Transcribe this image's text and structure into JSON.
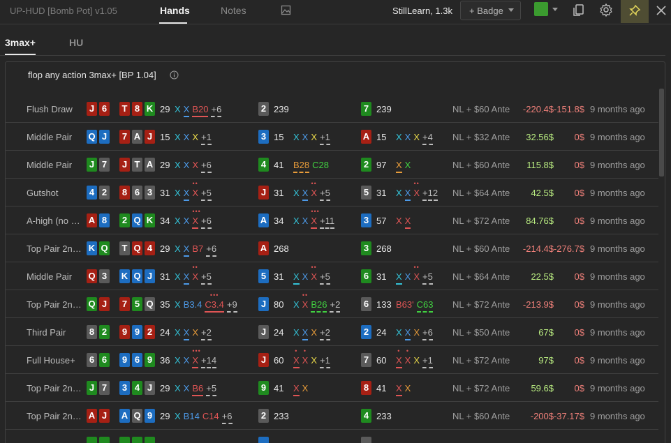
{
  "app": {
    "title": "UP-HUD [Bomb Pot] v1.05",
    "tabs": [
      "Hands",
      "Notes"
    ],
    "active_tab": "Hands",
    "user": "StillLearn, 1.3k",
    "badge_button": "+ Badge",
    "color_swatch": "#3b9b2f"
  },
  "subtabs": [
    "3max+",
    "HU"
  ],
  "panel": {
    "title": "flop any action 3max+ [BP 1.04]"
  },
  "colors": {
    "heart": "#a62014",
    "diamond": "#1d6dc0",
    "club": "#1f8a1f",
    "spade": "#5a5a5a",
    "positive": "#b8ea80",
    "negative": "#f0807a"
  },
  "rows": [
    {
      "name": "Flush Draw",
      "hole": [
        [
          "J",
          "h"
        ],
        [
          "6",
          "h"
        ]
      ],
      "flop": [
        [
          "T",
          "h"
        ],
        [
          "8",
          "h"
        ],
        [
          "K",
          "c"
        ]
      ],
      "pot": "29",
      "acts": [
        {
          "t": "X",
          "c": "cyan"
        },
        {
          "t": "X",
          "c": "blue",
          "u": 1
        },
        {
          "t": "B20",
          "c": "red",
          "u": 1
        },
        {
          "t": "+6",
          "c": "gray",
          "d": 1
        }
      ],
      "p2": {
        "card": [
          "2",
          "s"
        ],
        "pot": "239",
        "acts": []
      },
      "p3": {
        "card": [
          "7",
          "c"
        ],
        "pot": "239",
        "acts": []
      },
      "game": "NL + $60 Ante",
      "m1": "-220.4$",
      "m1s": "neg",
      "m2": "-151.8$",
      "m2s": "neg",
      "time": "9 months ago"
    },
    {
      "name": "Middle Pair",
      "hole": [
        [
          "Q",
          "d"
        ],
        [
          "J",
          "d"
        ]
      ],
      "flop": [
        [
          "7",
          "h"
        ],
        [
          "A",
          "s"
        ],
        [
          "J",
          "h"
        ]
      ],
      "pot": "15",
      "acts": [
        {
          "t": "X",
          "c": "cyan"
        },
        {
          "t": "X",
          "c": "blue"
        },
        {
          "t": "X",
          "c": "yellow"
        },
        {
          "t": "+1",
          "c": "gray",
          "d": 1
        }
      ],
      "p2": {
        "card": [
          "3",
          "d"
        ],
        "pot": "15",
        "acts": [
          {
            "t": "X",
            "c": "cyan"
          },
          {
            "t": "X",
            "c": "blue"
          },
          {
            "t": "X",
            "c": "yellow"
          },
          {
            "t": "+1",
            "c": "gray",
            "d": 1
          }
        ]
      },
      "p3": {
        "card": [
          "A",
          "h"
        ],
        "pot": "15",
        "acts": [
          {
            "t": "X",
            "c": "cyan"
          },
          {
            "t": "X",
            "c": "blue"
          },
          {
            "t": "X",
            "c": "yellow"
          },
          {
            "t": "+4",
            "c": "gray",
            "d": 1
          }
        ]
      },
      "game": "NL + $32 Ante",
      "m1": "32.56$",
      "m1s": "pos",
      "m2": "0$",
      "m2s": "neg",
      "time": "9 months ago"
    },
    {
      "name": "Middle Pair",
      "hole": [
        [
          "J",
          "c"
        ],
        [
          "7",
          "s"
        ]
      ],
      "flop": [
        [
          "J",
          "h"
        ],
        [
          "T",
          "s"
        ],
        [
          "A",
          "s"
        ]
      ],
      "pot": "29",
      "acts": [
        {
          "t": "X",
          "c": "cyan"
        },
        {
          "t": "X",
          "c": "blue"
        },
        {
          "t": "X",
          "c": "red"
        },
        {
          "t": "+6",
          "c": "gray",
          "d": 1
        }
      ],
      "p2": {
        "card": [
          "4",
          "c"
        ],
        "pot": "41",
        "acts": [
          {
            "t": "B28",
            "c": "orange",
            "d": 1
          },
          {
            "t": "C28",
            "c": "green"
          }
        ]
      },
      "p3": {
        "card": [
          "2",
          "c"
        ],
        "pot": "97",
        "acts": [
          {
            "t": "X",
            "c": "orange",
            "u": 1
          },
          {
            "t": "X",
            "c": "green"
          }
        ]
      },
      "game": "NL + $60 Ante",
      "m1": "115.8$",
      "m1s": "pos",
      "m2": "0$",
      "m2s": "neg",
      "time": "9 months ago"
    },
    {
      "name": "Gutshot",
      "hole": [
        [
          "4",
          "d"
        ],
        [
          "2",
          "s"
        ]
      ],
      "flop": [
        [
          "8",
          "h"
        ],
        [
          "6",
          "s"
        ],
        [
          "3",
          "s"
        ]
      ],
      "pot": "31",
      "acts": [
        {
          "t": "X",
          "c": "cyan"
        },
        {
          "t": "X",
          "c": "blue",
          "u": 1
        },
        {
          "t": "X",
          "c": "red",
          "dots": "••"
        },
        {
          "t": "+5",
          "c": "gray",
          "d": 1
        }
      ],
      "p2": {
        "card": [
          "J",
          "h"
        ],
        "pot": "31",
        "acts": [
          {
            "t": "X",
            "c": "cyan"
          },
          {
            "t": "X",
            "c": "blue",
            "u": 1
          },
          {
            "t": "X",
            "c": "red",
            "dots": "••"
          },
          {
            "t": "+5",
            "c": "gray",
            "d": 1
          }
        ]
      },
      "p3": {
        "card": [
          "5",
          "s"
        ],
        "pot": "31",
        "acts": [
          {
            "t": "X",
            "c": "cyan"
          },
          {
            "t": "X",
            "c": "blue",
            "u": 1
          },
          {
            "t": "X",
            "c": "red",
            "dots": "••"
          },
          {
            "t": "+12",
            "c": "gray",
            "d": 1
          }
        ]
      },
      "game": "NL + $64 Ante",
      "m1": "42.5$",
      "m1s": "pos",
      "m2": "0$",
      "m2s": "neg",
      "time": "9 months ago"
    },
    {
      "name": "A-high (no …",
      "hole": [
        [
          "A",
          "h"
        ],
        [
          "8",
          "d"
        ]
      ],
      "flop": [
        [
          "2",
          "c"
        ],
        [
          "Q",
          "d"
        ],
        [
          "K",
          "c"
        ]
      ],
      "pot": "34",
      "acts": [
        {
          "t": "X",
          "c": "cyan"
        },
        {
          "t": "X",
          "c": "blue"
        },
        {
          "t": "X",
          "c": "red",
          "u": 1,
          "dots": "•••"
        },
        {
          "t": "+6",
          "c": "gray",
          "d": 1
        }
      ],
      "p2": {
        "card": [
          "A",
          "d"
        ],
        "pot": "34",
        "acts": [
          {
            "t": "X",
            "c": "cyan"
          },
          {
            "t": "X",
            "c": "blue"
          },
          {
            "t": "X",
            "c": "red",
            "u": 1,
            "dots": "•••"
          },
          {
            "t": "+11",
            "c": "gray",
            "d": 1
          }
        ]
      },
      "p3": {
        "card": [
          "3",
          "d"
        ],
        "pot": "57",
        "acts": [
          {
            "t": "X",
            "c": "red"
          },
          {
            "t": "X",
            "c": "red",
            "u": 1
          }
        ]
      },
      "game": "NL + $72 Ante",
      "m1": "84.76$",
      "m1s": "pos",
      "m2": "0$",
      "m2s": "neg",
      "time": "9 months ago"
    },
    {
      "name": "Top Pair 2n…",
      "hole": [
        [
          "K",
          "d"
        ],
        [
          "Q",
          "c"
        ]
      ],
      "flop": [
        [
          "T",
          "s"
        ],
        [
          "Q",
          "h"
        ],
        [
          "4",
          "h"
        ]
      ],
      "pot": "29",
      "acts": [
        {
          "t": "X",
          "c": "cyan"
        },
        {
          "t": "X",
          "c": "blue",
          "u": 1
        },
        {
          "t": "B7",
          "c": "red"
        },
        {
          "t": "+6",
          "c": "gray",
          "d": 1
        }
      ],
      "p2": {
        "card": [
          "A",
          "h"
        ],
        "pot": "268",
        "acts": []
      },
      "p3": {
        "card": [
          "3",
          "c"
        ],
        "pot": "268",
        "acts": []
      },
      "game": "NL + $60 Ante",
      "m1": "-214.4$",
      "m1s": "neg",
      "m2": "-276.7$",
      "m2s": "neg",
      "time": "9 months ago"
    },
    {
      "name": "Middle Pair",
      "hole": [
        [
          "Q",
          "h"
        ],
        [
          "3",
          "s"
        ]
      ],
      "flop": [
        [
          "K",
          "d"
        ],
        [
          "Q",
          "d"
        ],
        [
          "J",
          "d"
        ]
      ],
      "pot": "31",
      "acts": [
        {
          "t": "X",
          "c": "cyan"
        },
        {
          "t": "X",
          "c": "blue",
          "u": 1
        },
        {
          "t": "X",
          "c": "red",
          "dots": "••"
        },
        {
          "t": "+5",
          "c": "gray",
          "d": 1
        }
      ],
      "p2": {
        "card": [
          "5",
          "d"
        ],
        "pot": "31",
        "acts": [
          {
            "t": "X",
            "c": "cyan",
            "u": 1
          },
          {
            "t": "X",
            "c": "blue"
          },
          {
            "t": "X",
            "c": "red",
            "dots": "••"
          },
          {
            "t": "+5",
            "c": "gray",
            "d": 1
          }
        ]
      },
      "p3": {
        "card": [
          "6",
          "c"
        ],
        "pot": "31",
        "acts": [
          {
            "t": "X",
            "c": "cyan",
            "u": 1
          },
          {
            "t": "X",
            "c": "blue"
          },
          {
            "t": "X",
            "c": "red",
            "dots": "••"
          },
          {
            "t": "+5",
            "c": "gray",
            "d": 1
          }
        ]
      },
      "game": "NL + $64 Ante",
      "m1": "22.5$",
      "m1s": "pos",
      "m2": "0$",
      "m2s": "neg",
      "time": "9 months ago"
    },
    {
      "name": "Top Pair 2n…",
      "hole": [
        [
          "Q",
          "c"
        ],
        [
          "J",
          "h"
        ]
      ],
      "flop": [
        [
          "7",
          "h"
        ],
        [
          "5",
          "c"
        ],
        [
          "Q",
          "s"
        ]
      ],
      "pot": "35",
      "acts": [
        {
          "t": "X",
          "c": "cyan"
        },
        {
          "t": "B3.4",
          "c": "blue"
        },
        {
          "t": "C3.4",
          "c": "red",
          "u": 1,
          "dots": "•••"
        },
        {
          "t": "+9",
          "c": "gray",
          "d": 1
        }
      ],
      "p2": {
        "card": [
          "J",
          "d"
        ],
        "pot": "80",
        "acts": [
          {
            "t": "X",
            "c": "cyan"
          },
          {
            "t": "X",
            "c": "red",
            "dots": "••"
          },
          {
            "t": "B26",
            "c": "green",
            "d": 1
          },
          {
            "t": "+2",
            "c": "gray",
            "d": 1
          }
        ]
      },
      "p3": {
        "card": [
          "6",
          "s"
        ],
        "pot": "133",
        "acts": [
          {
            "t": "B63'",
            "c": "red"
          },
          {
            "t": "C63",
            "c": "green",
            "d": 1
          }
        ]
      },
      "game": "NL + $72 Ante",
      "m1": "-213.9$",
      "m1s": "neg",
      "m2": "0$",
      "m2s": "neg",
      "time": "9 months ago"
    },
    {
      "name": "Third Pair",
      "hole": [
        [
          "8",
          "s"
        ],
        [
          "2",
          "c"
        ]
      ],
      "flop": [
        [
          "9",
          "h"
        ],
        [
          "9",
          "d"
        ],
        [
          "2",
          "h"
        ]
      ],
      "pot": "24",
      "acts": [
        {
          "t": "X",
          "c": "cyan"
        },
        {
          "t": "X",
          "c": "blue",
          "u": 1
        },
        {
          "t": "X",
          "c": "orange"
        },
        {
          "t": "+2",
          "c": "gray",
          "d": 1
        }
      ],
      "p2": {
        "card": [
          "J",
          "s"
        ],
        "pot": "24",
        "acts": [
          {
            "t": "X",
            "c": "cyan"
          },
          {
            "t": "X",
            "c": "blue",
            "u": 1
          },
          {
            "t": "X",
            "c": "orange"
          },
          {
            "t": "+2",
            "c": "gray",
            "d": 1
          }
        ]
      },
      "p3": {
        "card": [
          "2",
          "d"
        ],
        "pot": "24",
        "acts": [
          {
            "t": "X",
            "c": "cyan"
          },
          {
            "t": "X",
            "c": "blue",
            "u": 1
          },
          {
            "t": "X",
            "c": "orange"
          },
          {
            "t": "+6",
            "c": "gray",
            "d": 1
          }
        ]
      },
      "game": "NL + $50 Ante",
      "m1": "67$",
      "m1s": "pos",
      "m2": "0$",
      "m2s": "neg",
      "time": "9 months ago"
    },
    {
      "name": "Full House+",
      "hole": [
        [
          "6",
          "s"
        ],
        [
          "6",
          "c"
        ]
      ],
      "flop": [
        [
          "9",
          "d"
        ],
        [
          "6",
          "d"
        ],
        [
          "9",
          "c"
        ]
      ],
      "pot": "36",
      "acts": [
        {
          "t": "X",
          "c": "cyan"
        },
        {
          "t": "X",
          "c": "blue"
        },
        {
          "t": "X",
          "c": "red",
          "u": 1,
          "dots": "•••"
        },
        {
          "t": "+14",
          "c": "gray",
          "d": 1
        }
      ],
      "p2": {
        "card": [
          "J",
          "h"
        ],
        "pot": "60",
        "acts": [
          {
            "t": "X",
            "c": "red",
            "u": 1,
            "dots": "•"
          },
          {
            "t": "X",
            "c": "red",
            "dots": "•"
          },
          {
            "t": "X",
            "c": "yellow"
          },
          {
            "t": "+1",
            "c": "gray",
            "d": 1
          }
        ]
      },
      "p3": {
        "card": [
          "7",
          "s"
        ],
        "pot": "60",
        "acts": [
          {
            "t": "X",
            "c": "red",
            "u": 1,
            "dots": "•"
          },
          {
            "t": "X",
            "c": "red",
            "dots": "•"
          },
          {
            "t": "X",
            "c": "yellow"
          },
          {
            "t": "+1",
            "c": "gray",
            "d": 1
          }
        ]
      },
      "game": "NL + $72 Ante",
      "m1": "97$",
      "m1s": "pos",
      "m2": "0$",
      "m2s": "neg",
      "time": "9 months ago"
    },
    {
      "name": "Top Pair 2n…",
      "hole": [
        [
          "J",
          "c"
        ],
        [
          "7",
          "s"
        ]
      ],
      "flop": [
        [
          "3",
          "d"
        ],
        [
          "4",
          "c"
        ],
        [
          "J",
          "s"
        ]
      ],
      "pot": "29",
      "acts": [
        {
          "t": "X",
          "c": "cyan"
        },
        {
          "t": "X",
          "c": "blue"
        },
        {
          "t": "B6",
          "c": "red",
          "u": 1
        },
        {
          "t": "+5",
          "c": "gray",
          "d": 1
        }
      ],
      "p2": {
        "card": [
          "9",
          "c"
        ],
        "pot": "41",
        "acts": [
          {
            "t": "X",
            "c": "red",
            "u": 1
          },
          {
            "t": "X",
            "c": "orange"
          }
        ]
      },
      "p3": {
        "card": [
          "8",
          "h"
        ],
        "pot": "41",
        "acts": [
          {
            "t": "X",
            "c": "red",
            "u": 1
          },
          {
            "t": "X",
            "c": "orange"
          }
        ]
      },
      "game": "NL + $72 Ante",
      "m1": "59.6$",
      "m1s": "pos",
      "m2": "0$",
      "m2s": "neg",
      "time": "9 months ago"
    },
    {
      "name": "Top Pair 2n…",
      "hole": [
        [
          "A",
          "h"
        ],
        [
          "J",
          "h"
        ]
      ],
      "flop": [
        [
          "A",
          "d"
        ],
        [
          "Q",
          "s"
        ],
        [
          "9",
          "d"
        ]
      ],
      "pot": "29",
      "acts": [
        {
          "t": "X",
          "c": "cyan"
        },
        {
          "t": "B14",
          "c": "blue"
        },
        {
          "t": "C14",
          "c": "red"
        },
        {
          "t": "+6",
          "c": "gray",
          "d": 1
        }
      ],
      "p2": {
        "card": [
          "2",
          "s"
        ],
        "pot": "233",
        "acts": []
      },
      "p3": {
        "card": [
          "4",
          "c"
        ],
        "pot": "233",
        "acts": []
      },
      "game": "NL + $60 Ante",
      "m1": "-200$",
      "m1s": "neg",
      "m2": "-37.17$",
      "m2s": "neg",
      "time": "9 months ago"
    },
    {
      "name": "",
      "hole": [
        [
          "",
          "c"
        ],
        [
          "",
          "c"
        ]
      ],
      "flop": [
        [
          "",
          "c"
        ],
        [
          "",
          "c"
        ],
        [
          "",
          "c"
        ]
      ],
      "pot": "",
      "acts": [],
      "p2": {
        "card": [
          "",
          "d"
        ],
        "pot": "",
        "acts": []
      },
      "p3": {
        "card": [
          "",
          "s"
        ],
        "pot": "",
        "acts": []
      },
      "game": "",
      "m1": "",
      "m1s": "pos",
      "m2": "",
      "m2s": "neg",
      "time": ""
    }
  ]
}
